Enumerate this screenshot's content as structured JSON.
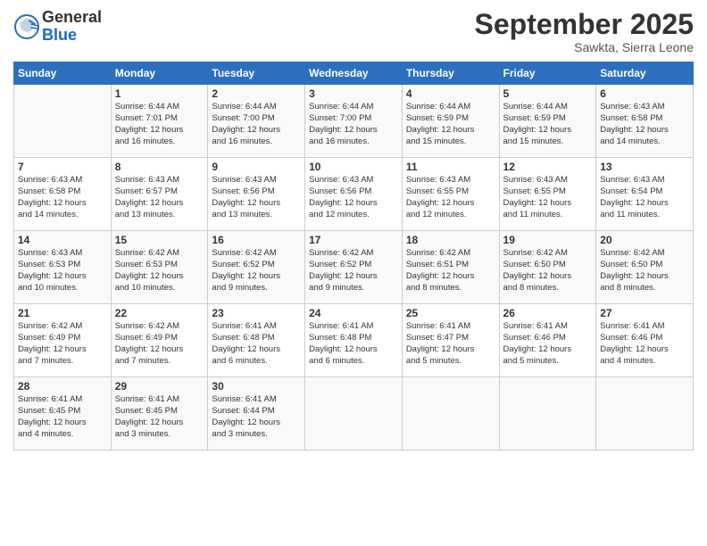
{
  "header": {
    "logo_general": "General",
    "logo_blue": "Blue",
    "month_title": "September 2025",
    "location": "Sawkta, Sierra Leone"
  },
  "days_of_week": [
    "Sunday",
    "Monday",
    "Tuesday",
    "Wednesday",
    "Thursday",
    "Friday",
    "Saturday"
  ],
  "weeks": [
    [
      {
        "num": "",
        "info": ""
      },
      {
        "num": "1",
        "info": "Sunrise: 6:44 AM\nSunset: 7:01 PM\nDaylight: 12 hours\nand 16 minutes."
      },
      {
        "num": "2",
        "info": "Sunrise: 6:44 AM\nSunset: 7:00 PM\nDaylight: 12 hours\nand 16 minutes."
      },
      {
        "num": "3",
        "info": "Sunrise: 6:44 AM\nSunset: 7:00 PM\nDaylight: 12 hours\nand 16 minutes."
      },
      {
        "num": "4",
        "info": "Sunrise: 6:44 AM\nSunset: 6:59 PM\nDaylight: 12 hours\nand 15 minutes."
      },
      {
        "num": "5",
        "info": "Sunrise: 6:44 AM\nSunset: 6:59 PM\nDaylight: 12 hours\nand 15 minutes."
      },
      {
        "num": "6",
        "info": "Sunrise: 6:43 AM\nSunset: 6:58 PM\nDaylight: 12 hours\nand 14 minutes."
      }
    ],
    [
      {
        "num": "7",
        "info": "Sunrise: 6:43 AM\nSunset: 6:58 PM\nDaylight: 12 hours\nand 14 minutes."
      },
      {
        "num": "8",
        "info": "Sunrise: 6:43 AM\nSunset: 6:57 PM\nDaylight: 12 hours\nand 13 minutes."
      },
      {
        "num": "9",
        "info": "Sunrise: 6:43 AM\nSunset: 6:56 PM\nDaylight: 12 hours\nand 13 minutes."
      },
      {
        "num": "10",
        "info": "Sunrise: 6:43 AM\nSunset: 6:56 PM\nDaylight: 12 hours\nand 12 minutes."
      },
      {
        "num": "11",
        "info": "Sunrise: 6:43 AM\nSunset: 6:55 PM\nDaylight: 12 hours\nand 12 minutes."
      },
      {
        "num": "12",
        "info": "Sunrise: 6:43 AM\nSunset: 6:55 PM\nDaylight: 12 hours\nand 11 minutes."
      },
      {
        "num": "13",
        "info": "Sunrise: 6:43 AM\nSunset: 6:54 PM\nDaylight: 12 hours\nand 11 minutes."
      }
    ],
    [
      {
        "num": "14",
        "info": "Sunrise: 6:43 AM\nSunset: 6:53 PM\nDaylight: 12 hours\nand 10 minutes."
      },
      {
        "num": "15",
        "info": "Sunrise: 6:42 AM\nSunset: 6:53 PM\nDaylight: 12 hours\nand 10 minutes."
      },
      {
        "num": "16",
        "info": "Sunrise: 6:42 AM\nSunset: 6:52 PM\nDaylight: 12 hours\nand 9 minutes."
      },
      {
        "num": "17",
        "info": "Sunrise: 6:42 AM\nSunset: 6:52 PM\nDaylight: 12 hours\nand 9 minutes."
      },
      {
        "num": "18",
        "info": "Sunrise: 6:42 AM\nSunset: 6:51 PM\nDaylight: 12 hours\nand 8 minutes."
      },
      {
        "num": "19",
        "info": "Sunrise: 6:42 AM\nSunset: 6:50 PM\nDaylight: 12 hours\nand 8 minutes."
      },
      {
        "num": "20",
        "info": "Sunrise: 6:42 AM\nSunset: 6:50 PM\nDaylight: 12 hours\nand 8 minutes."
      }
    ],
    [
      {
        "num": "21",
        "info": "Sunrise: 6:42 AM\nSunset: 6:49 PM\nDaylight: 12 hours\nand 7 minutes."
      },
      {
        "num": "22",
        "info": "Sunrise: 6:42 AM\nSunset: 6:49 PM\nDaylight: 12 hours\nand 7 minutes."
      },
      {
        "num": "23",
        "info": "Sunrise: 6:41 AM\nSunset: 6:48 PM\nDaylight: 12 hours\nand 6 minutes."
      },
      {
        "num": "24",
        "info": "Sunrise: 6:41 AM\nSunset: 6:48 PM\nDaylight: 12 hours\nand 6 minutes."
      },
      {
        "num": "25",
        "info": "Sunrise: 6:41 AM\nSunset: 6:47 PM\nDaylight: 12 hours\nand 5 minutes."
      },
      {
        "num": "26",
        "info": "Sunrise: 6:41 AM\nSunset: 6:46 PM\nDaylight: 12 hours\nand 5 minutes."
      },
      {
        "num": "27",
        "info": "Sunrise: 6:41 AM\nSunset: 6:46 PM\nDaylight: 12 hours\nand 4 minutes."
      }
    ],
    [
      {
        "num": "28",
        "info": "Sunrise: 6:41 AM\nSunset: 6:45 PM\nDaylight: 12 hours\nand 4 minutes."
      },
      {
        "num": "29",
        "info": "Sunrise: 6:41 AM\nSunset: 6:45 PM\nDaylight: 12 hours\nand 3 minutes."
      },
      {
        "num": "30",
        "info": "Sunrise: 6:41 AM\nSunset: 6:44 PM\nDaylight: 12 hours\nand 3 minutes."
      },
      {
        "num": "",
        "info": ""
      },
      {
        "num": "",
        "info": ""
      },
      {
        "num": "",
        "info": ""
      },
      {
        "num": "",
        "info": ""
      }
    ]
  ]
}
